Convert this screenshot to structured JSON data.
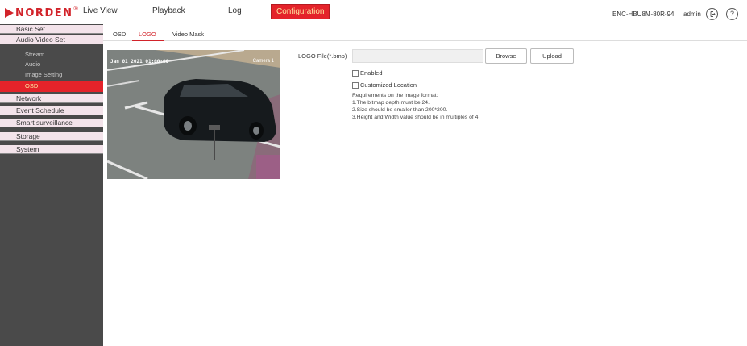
{
  "brand": {
    "name": "NORDEN",
    "reg": "®"
  },
  "nav": {
    "live_view": "Live View",
    "playback": "Playback",
    "log": "Log",
    "configuration": "Configuration"
  },
  "device": "ENC-HBU8M-80R-94",
  "user": "admin",
  "icons": {
    "logout": "logout-icon",
    "help": "help-icon"
  },
  "sidebar": {
    "basic_set": "Basic Set",
    "audio_video_set": "Audio Video Set",
    "sub": {
      "stream": "Stream",
      "audio": "Audio",
      "image_setting": "Image Setting",
      "osd": "OSD"
    },
    "network": "Network",
    "event_schedule": "Event Schedule",
    "smart_surveillance": "Smart surveillance",
    "storage": "Storage",
    "system": "System"
  },
  "tabs": {
    "osd": "OSD",
    "logo": "LOGO",
    "video_mask": "Video Mask"
  },
  "preview": {
    "date_overlay": "Jan 01 2021 01:00:00",
    "channel_overlay": "Camera 1"
  },
  "form": {
    "logo_file_label": "LOGO File(*.bmp)",
    "logo_file_value": "",
    "browse": "Browse",
    "upload": "Upload",
    "enabled": "Enabled",
    "enabled_checked": false,
    "customized_location": "Customized Location",
    "customized_checked": false
  },
  "requirements": {
    "title": "Requirements on the image format:",
    "items": [
      "1.The bitmap depth must be 24.",
      "2.Size should be smaller than 200*200.",
      "3.Height and Width value should be in multiples of 4."
    ]
  },
  "colors": {
    "accent": "#e4232a",
    "sidebar": "#4a4a4a",
    "menu": "#f3e3ea",
    "active_text": "#fde8a0"
  }
}
